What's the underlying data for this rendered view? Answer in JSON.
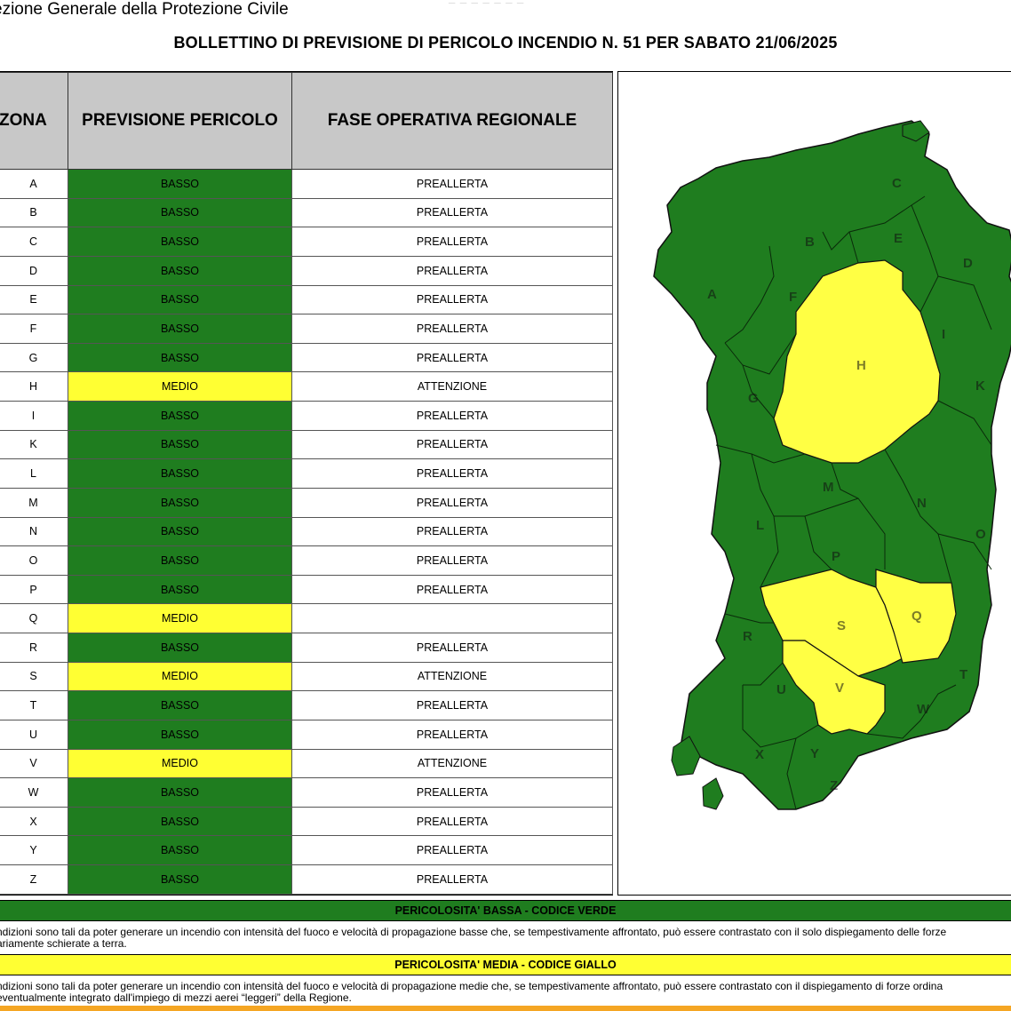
{
  "header": {
    "institution": "ezione Generale della Protezione Civile",
    "title": "BOLLETTINO DI PREVISIONE DI PERICOLO INCENDIO N. 51 PER SABATO 21/06/2025"
  },
  "table": {
    "columns": [
      "ZONA",
      "PREVISIONE PERICOLO",
      "FASE OPERATIVA REGIONALE"
    ],
    "rows": [
      {
        "zone": "A",
        "level": "BASSO",
        "phase": "PREALLERTA"
      },
      {
        "zone": "B",
        "level": "BASSO",
        "phase": "PREALLERTA"
      },
      {
        "zone": "C",
        "level": "BASSO",
        "phase": "PREALLERTA"
      },
      {
        "zone": "D",
        "level": "BASSO",
        "phase": "PREALLERTA"
      },
      {
        "zone": "E",
        "level": "BASSO",
        "phase": "PREALLERTA"
      },
      {
        "zone": "F",
        "level": "BASSO",
        "phase": "PREALLERTA"
      },
      {
        "zone": "G",
        "level": "BASSO",
        "phase": "PREALLERTA"
      },
      {
        "zone": "H",
        "level": "MEDIO",
        "phase": "ATTENZIONE"
      },
      {
        "zone": "I",
        "level": "BASSO",
        "phase": "PREALLERTA"
      },
      {
        "zone": "K",
        "level": "BASSO",
        "phase": "PREALLERTA"
      },
      {
        "zone": "L",
        "level": "BASSO",
        "phase": "PREALLERTA"
      },
      {
        "zone": "M",
        "level": "BASSO",
        "phase": "PREALLERTA"
      },
      {
        "zone": "N",
        "level": "BASSO",
        "phase": "PREALLERTA"
      },
      {
        "zone": "O",
        "level": "BASSO",
        "phase": "PREALLERTA"
      },
      {
        "zone": "P",
        "level": "BASSO",
        "phase": "PREALLERTA"
      },
      {
        "zone": "Q",
        "level": "MEDIO",
        "phase": ""
      },
      {
        "zone": "R",
        "level": "BASSO",
        "phase": "PREALLERTA"
      },
      {
        "zone": "S",
        "level": "MEDIO",
        "phase": "ATTENZIONE"
      },
      {
        "zone": "T",
        "level": "BASSO",
        "phase": "PREALLERTA"
      },
      {
        "zone": "U",
        "level": "BASSO",
        "phase": "PREALLERTA"
      },
      {
        "zone": "V",
        "level": "MEDIO",
        "phase": "ATTENZIONE"
      },
      {
        "zone": "W",
        "level": "BASSO",
        "phase": "PREALLERTA"
      },
      {
        "zone": "X",
        "level": "BASSO",
        "phase": "PREALLERTA"
      },
      {
        "zone": "Y",
        "level": "BASSO",
        "phase": "PREALLERTA"
      },
      {
        "zone": "Z",
        "level": "BASSO",
        "phase": "PREALLERTA"
      }
    ]
  },
  "map": {
    "zone_labels": [
      "A",
      "B",
      "C",
      "D",
      "E",
      "F",
      "G",
      "H",
      "I",
      "K",
      "L",
      "M",
      "N",
      "O",
      "P",
      "Q",
      "R",
      "S",
      "T",
      "U",
      "V",
      "W",
      "X",
      "Y",
      "Z"
    ]
  },
  "legend": {
    "green_title": "PERICOLOSITA' BASSA - CODICE VERDE",
    "green_text_1": "ndizioni sono tali da poter generare un incendio con intensità del fuoco e velocità di propagazione basse che, se tempestivamente affrontato, può essere contrastato con il solo dispiegamento delle forze",
    "green_text_2": "ariamente schierate a terra.",
    "yellow_title": "PERICOLOSITA' MEDIA - CODICE GIALLO",
    "yellow_text_1": "ndizioni sono tali da poter generare un incendio con intensità del fuoco e velocità di propagazione medie che, se tempestivamente affrontato, può essere contrastato con il dispiegamento di forze ordina",
    "yellow_text_2": "eventualmente integrato dall'impiego di mezzi aerei “leggeri” della Regione."
  },
  "colors": {
    "basso": "#1f7d1f",
    "medio": "#ffff33",
    "header_bg": "#c8c8c8",
    "accent_orange": "#f5a623"
  }
}
